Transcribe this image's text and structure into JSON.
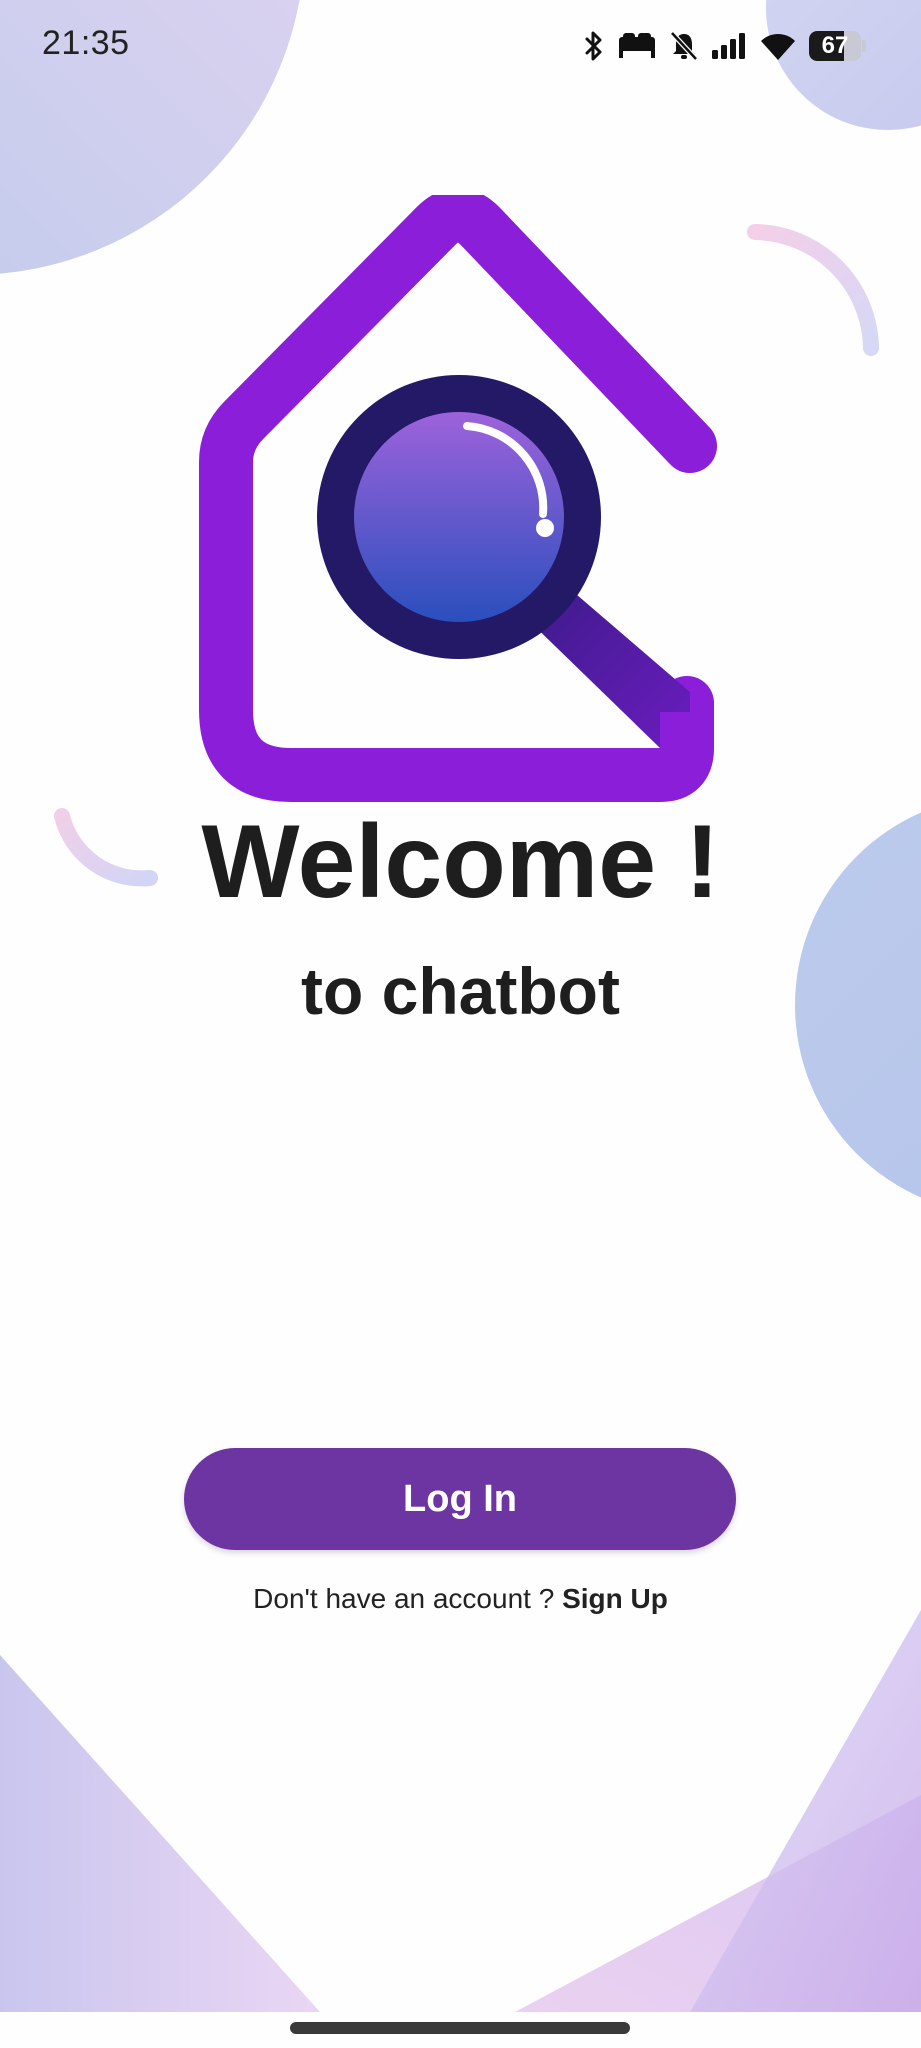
{
  "status_bar": {
    "time": "21:35",
    "icons": [
      "bluetooth-icon",
      "bed-icon",
      "bell-off-icon",
      "signal-icon",
      "wifi-icon"
    ],
    "battery_level": "67"
  },
  "logo": {
    "icon": "house-search-icon",
    "colors": {
      "house": "#8b1fd9",
      "lens_ring": "#241967",
      "lens_top": "#9d62db",
      "lens_bottom": "#2a4fbd"
    }
  },
  "welcome": {
    "title": "Welcome !",
    "subtitle": "to chatbot"
  },
  "actions": {
    "login_label": "Log In",
    "signup_prompt": "Don't have an account ?",
    "signup_link": "Sign Up"
  },
  "colors": {
    "primary": "#6d35a2",
    "text": "#1e1e1e",
    "background": "#fefefe"
  }
}
